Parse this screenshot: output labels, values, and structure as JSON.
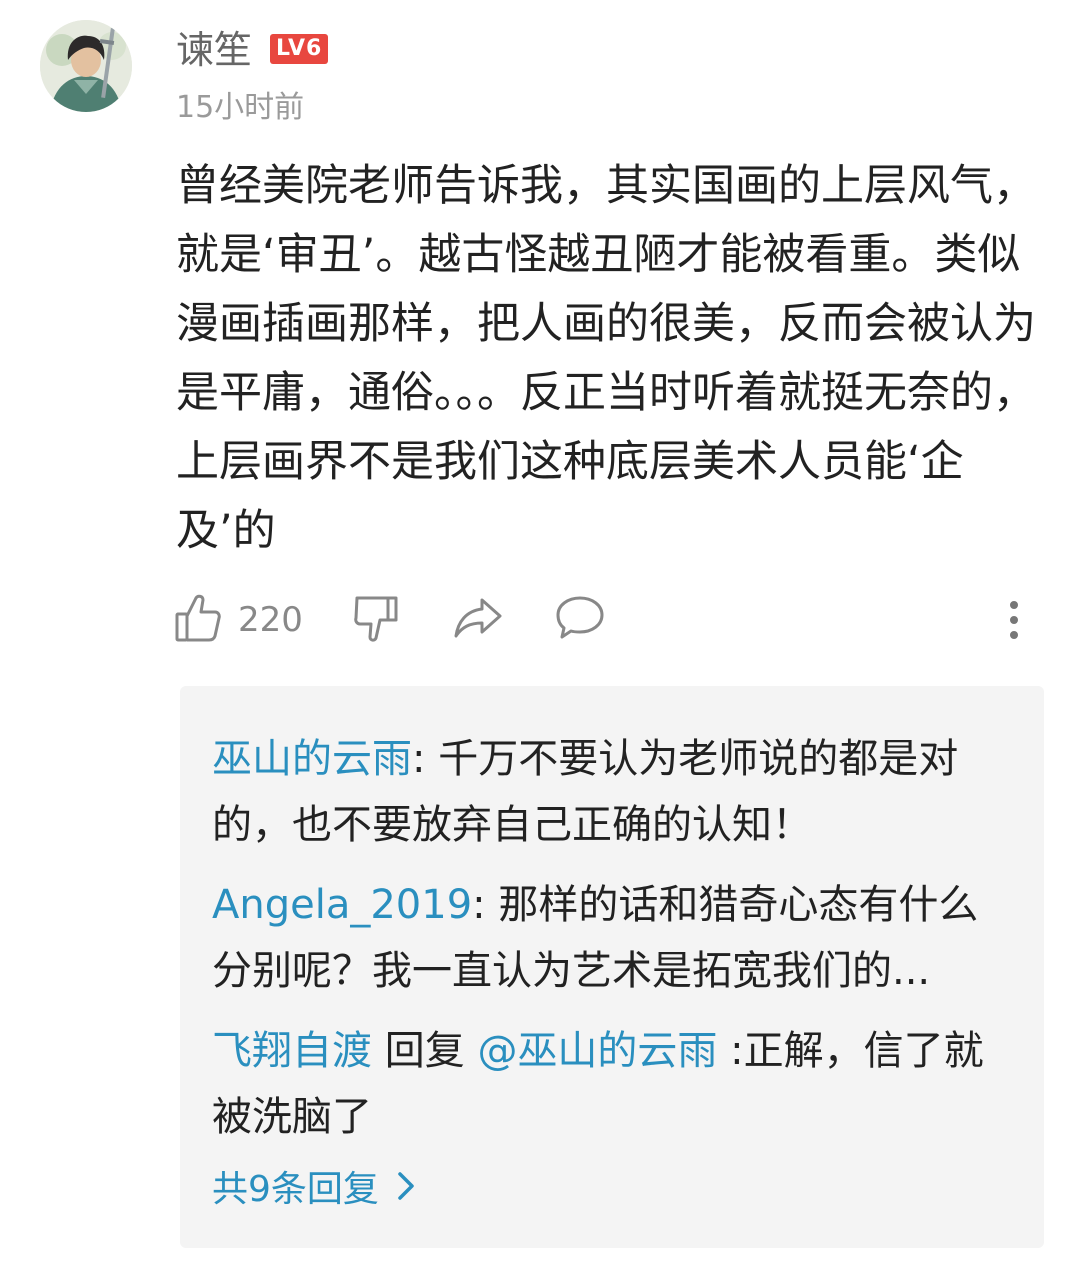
{
  "comment": {
    "username": "谏笙",
    "level_badge": "LV6",
    "timestamp": "15小时前",
    "text": "曾经美院老师告诉我，其实国画的上层风气，就是‘审丑’。越古怪越丑陋才能被看重。类似漫画插画那样，把人画的很美，反而会被认为是平庸，通俗。。。反正当时听着就挺无奈的，上层画界不是我们这种底层美术人员能‘企及’的",
    "like_count": "220",
    "icons": [
      "thumbs-up-icon",
      "thumbs-down-icon",
      "share-icon",
      "comment-icon",
      "more-vertical-icon"
    ]
  },
  "replies": [
    {
      "author": "巫山的云雨",
      "separator": ": ",
      "text": "千万不要认为老师说的都是对的，也不要放弃自己正确的认知！"
    },
    {
      "author": "Angela_2019",
      "separator": ": ",
      "text": "那样的话和猎奇心态有什么分别呢？我一直认为艺术是拓宽我们的..."
    },
    {
      "author": "飞翔自渡",
      "reply_word": " 回复 ",
      "mention": "@巫山的云雨",
      "separator": " :",
      "text": "正解，信了就被洗脑了"
    }
  ],
  "more_replies_label": "共9条回复",
  "colors": {
    "link_blue": "#2a8fbf",
    "badge_red": "#e8473f",
    "muted_gray": "#9a9a9a",
    "reply_bg": "#f4f4f4"
  }
}
